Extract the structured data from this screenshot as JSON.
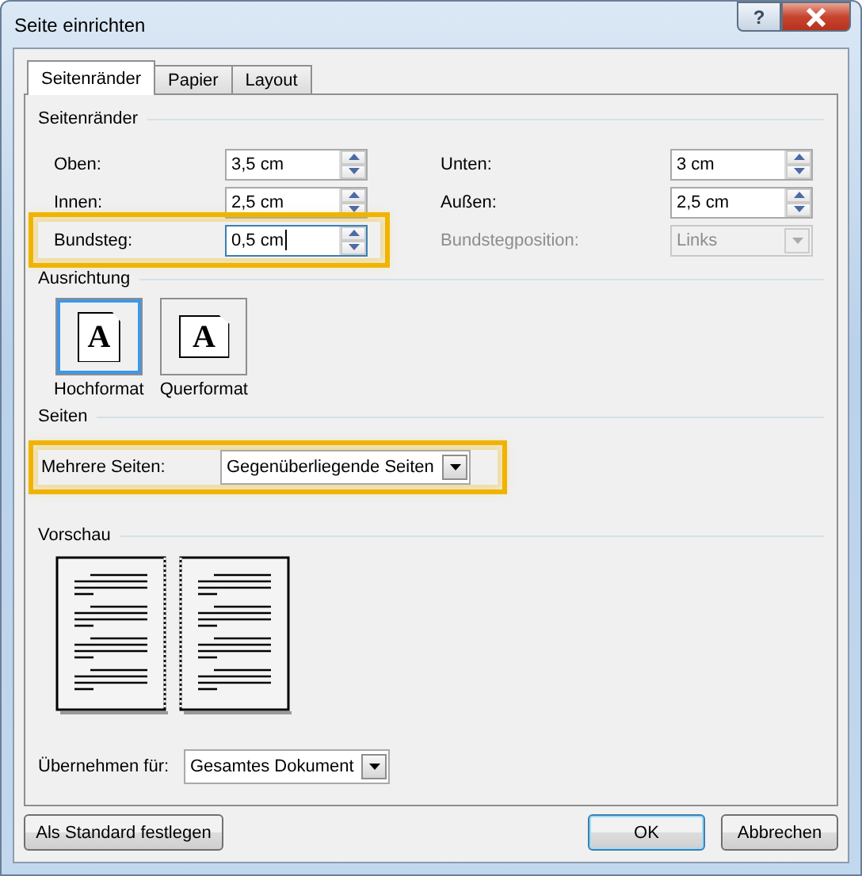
{
  "window": {
    "title": "Seite einrichten",
    "help": "?"
  },
  "tabs": [
    {
      "label": "Seitenränder",
      "selected": true
    },
    {
      "label": "Papier",
      "selected": false
    },
    {
      "label": "Layout",
      "selected": false
    }
  ],
  "margins": {
    "title": "Seitenränder",
    "rows": [
      {
        "highlighted": false,
        "left": {
          "label": "Oben:",
          "value": "3,5 cm",
          "kind": "spin",
          "disabled": false,
          "focused": false
        },
        "right": {
          "label": "Unten:",
          "value": "3 cm",
          "kind": "spin",
          "disabled": false,
          "focused": false
        }
      },
      {
        "highlighted": false,
        "left": {
          "label": "Innen:",
          "value": "2,5 cm",
          "kind": "spin",
          "disabled": false,
          "focused": false
        },
        "right": {
          "label": "Außen:",
          "value": "2,5 cm",
          "kind": "spin",
          "disabled": false,
          "focused": false
        }
      },
      {
        "highlighted": true,
        "left": {
          "label": "Bundsteg:",
          "value": "0,5 cm",
          "kind": "spin",
          "disabled": false,
          "focused": true
        },
        "right": {
          "label": "Bundstegposition:",
          "value": "Links",
          "kind": "dropdown",
          "disabled": true,
          "focused": false
        }
      }
    ]
  },
  "orientation": {
    "title": "Ausrichtung",
    "options": [
      {
        "label": "Hochformat",
        "letter": "A",
        "kind": "portrait",
        "selected": true
      },
      {
        "label": "Querformat",
        "letter": "A",
        "kind": "landscape",
        "selected": false
      }
    ]
  },
  "pages": {
    "title": "Seiten",
    "label": "Mehrere Seiten:",
    "value": "Gegenüberliegende Seiten",
    "highlighted": true
  },
  "preview": {
    "title": "Vorschau"
  },
  "apply": {
    "label": "Übernehmen für:",
    "value": "Gesamtes Dokument"
  },
  "footer": {
    "left_button": {
      "label": "Als Standard festlegen",
      "default": false
    },
    "buttons": [
      {
        "label": "OK",
        "default": true
      },
      {
        "label": "Abbrechen",
        "default": false
      }
    ]
  }
}
